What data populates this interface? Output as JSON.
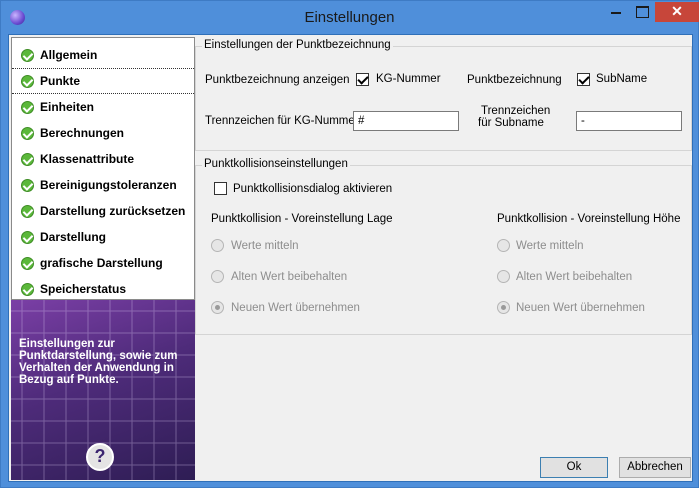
{
  "window": {
    "title": "Einstellungen",
    "close_glyph": "✕"
  },
  "sidebar": {
    "items": [
      {
        "label": "Allgemein"
      },
      {
        "label": "Punkte"
      },
      {
        "label": "Einheiten"
      },
      {
        "label": "Berechnungen"
      },
      {
        "label": "Klassenattribute"
      },
      {
        "label": "Bereinigungstoleranzen"
      },
      {
        "label": "Darstellung zurücksetzen"
      },
      {
        "label": "Darstellung"
      },
      {
        "label": "grafische Darstellung"
      },
      {
        "label": "Speicherstatus"
      }
    ],
    "selected": "Punkte",
    "promo_text": "Einstellungen zur Punktdarstellung, sowie zum Verhalten der Anwendung in Bezug auf Punkte.",
    "help_glyph": "?"
  },
  "naming_group": {
    "title": "Einstellungen der Punktbezeichnung",
    "show_label": "Punktbezeichnung anzeigen",
    "kg_checkbox_label": "KG-Nummer",
    "kg_checked": true,
    "punktbez_label": "Punktbezeichnung",
    "subname_checkbox_label": "SubName",
    "subname_checked": true,
    "sep_kg_label": "Trennzeichen für KG-Nummer",
    "sep_kg_value": "#",
    "sep_sub_label_line1": "Trennzeichen",
    "sep_sub_label_line2": "für Subname",
    "sep_sub_value": "-"
  },
  "collision_group": {
    "title": "Punktkollisionseinstellungen",
    "dialog_checkbox_label": "Punktkollisionsdialog aktivieren",
    "dialog_checked": false,
    "left_title": "Punktkollision - Voreinstellung Lage",
    "right_title": "Punktkollision - Voreinstellung Höhe",
    "options": [
      "Werte mitteln",
      "Alten Wert beibehalten",
      "Neuen Wert übernehmen"
    ],
    "left_selected": "Neuen Wert übernehmen",
    "right_selected": "Neuen Wert übernehmen"
  },
  "buttons": {
    "ok": "Ok",
    "cancel": "Abbrechen"
  }
}
